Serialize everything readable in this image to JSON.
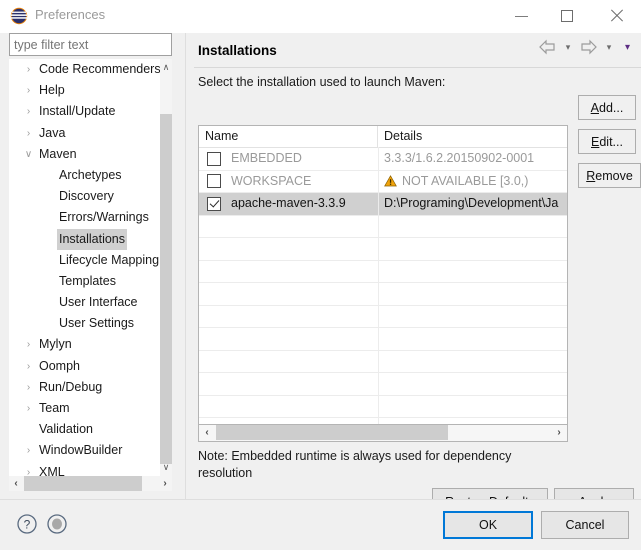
{
  "window": {
    "title": "Preferences",
    "icon": "eclipse-logo-icon",
    "minimize": "minimize-icon",
    "maximize": "maximize-icon",
    "close": "close-icon"
  },
  "filter": {
    "value": "",
    "placeholder": "type filter text"
  },
  "tree": {
    "items": [
      {
        "label": "Code Recommenders",
        "level": 1,
        "arrow": "›",
        "selected": false
      },
      {
        "label": "Help",
        "level": 1,
        "arrow": "›",
        "selected": false
      },
      {
        "label": "Install/Update",
        "level": 1,
        "arrow": "›",
        "selected": false
      },
      {
        "label": "Java",
        "level": 1,
        "arrow": "›",
        "selected": false
      },
      {
        "label": "Maven",
        "level": 1,
        "arrow": "∨",
        "selected": false
      },
      {
        "label": "Archetypes",
        "level": 2,
        "arrow": "",
        "selected": false
      },
      {
        "label": "Discovery",
        "level": 2,
        "arrow": "",
        "selected": false
      },
      {
        "label": "Errors/Warnings",
        "level": 2,
        "arrow": "",
        "selected": false
      },
      {
        "label": "Installations",
        "level": 2,
        "arrow": "",
        "selected": true
      },
      {
        "label": "Lifecycle Mapping",
        "level": 2,
        "arrow": "",
        "selected": false
      },
      {
        "label": "Templates",
        "level": 2,
        "arrow": "",
        "selected": false
      },
      {
        "label": "User Interface",
        "level": 2,
        "arrow": "",
        "selected": false
      },
      {
        "label": "User Settings",
        "level": 2,
        "arrow": "",
        "selected": false
      },
      {
        "label": "Mylyn",
        "level": 1,
        "arrow": "›",
        "selected": false
      },
      {
        "label": "Oomph",
        "level": 1,
        "arrow": "›",
        "selected": false
      },
      {
        "label": "Run/Debug",
        "level": 1,
        "arrow": "›",
        "selected": false
      },
      {
        "label": "Team",
        "level": 1,
        "arrow": "›",
        "selected": false
      },
      {
        "label": "Validation",
        "level": 1,
        "arrow": "",
        "selected": false
      },
      {
        "label": "WindowBuilder",
        "level": 1,
        "arrow": "›",
        "selected": false
      },
      {
        "label": "XML",
        "level": 1,
        "arrow": "›",
        "selected": false
      }
    ],
    "scroll_up": "∧",
    "scroll_down": "∨",
    "scroll_left": "‹",
    "scroll_right": "›"
  },
  "page": {
    "title": "Installations",
    "description": "Select the installation used to launch Maven:",
    "note": "Note: Embedded runtime is always used for dependency resolution"
  },
  "nav": {
    "back": "back-arrow-icon",
    "back_caret": "▾",
    "forward": "forward-arrow-icon",
    "forward_caret": "▾",
    "menu_caret": "▾",
    "menu_caret_color": "#5c2d83"
  },
  "table": {
    "columns": [
      "Name",
      "Details"
    ],
    "rows": [
      {
        "checked": false,
        "name": "EMBEDDED",
        "details": "3.3.3/1.6.2.20150902-0001",
        "warning": false,
        "selected": false
      },
      {
        "checked": false,
        "name": "WORKSPACE",
        "details": "NOT AVAILABLE [3.0,)",
        "warning": true,
        "selected": false
      },
      {
        "checked": true,
        "name": "apache-maven-3.3.9",
        "details": "D:\\Programing\\Development\\Ja",
        "warning": false,
        "selected": true
      }
    ],
    "empty_rows": 11,
    "scroll_left": "‹",
    "scroll_right": "›",
    "warning_color": "#f0a30a"
  },
  "side_buttons": [
    {
      "name": "add-button",
      "mnemonic": "A",
      "rest": "dd..."
    },
    {
      "name": "edit-button",
      "mnemonic": "E",
      "rest": "dit..."
    },
    {
      "name": "remove-button",
      "mnemonic": "R",
      "rest": "emove"
    }
  ],
  "page_buttons": {
    "restore_pre": "Restore ",
    "restore_mnemonic": "D",
    "restore_post": "efaults",
    "apply_mnemonic": "A",
    "apply_post": "pply"
  },
  "footer": {
    "help_icon": "help-icon",
    "pin_icon": "pin-icon",
    "ok": "OK",
    "cancel": "Cancel",
    "focus_color": "#0078d7"
  }
}
